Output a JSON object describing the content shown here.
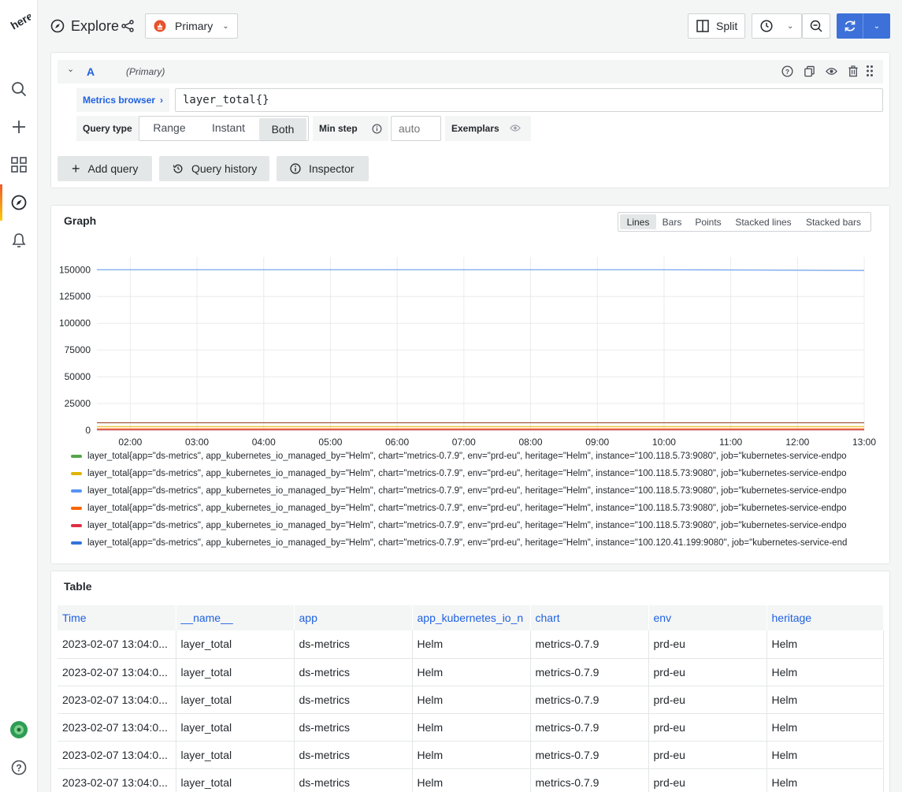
{
  "topbar": {
    "title": "Explore",
    "datasource": "Primary",
    "split_label": "Split"
  },
  "query": {
    "ref_id": "A",
    "datasource_hint": "(Primary)",
    "metrics_browser_label": "Metrics browser",
    "expression": "layer_total{}",
    "query_type_label": "Query type",
    "query_types": [
      "Range",
      "Instant",
      "Both"
    ],
    "selected_query_type": "Both",
    "min_step_label": "Min step",
    "min_step_placeholder": "auto",
    "exemplars_label": "Exemplars"
  },
  "actions": {
    "add_query": "Add query",
    "query_history": "Query history",
    "inspector": "Inspector"
  },
  "graph": {
    "title": "Graph",
    "modes": [
      "Lines",
      "Bars",
      "Points",
      "Stacked lines",
      "Stacked bars"
    ],
    "selected_mode": "Lines",
    "legend": [
      {
        "label": "layer_total{app=\"ds-metrics\", app_kubernetes_io_managed_by=\"Helm\", chart=\"metrics-0.7.9\", env=\"prd-eu\", heritage=\"Helm\", instance=\"100.118.5.73:9080\", job=\"kubernetes-service-endpo",
        "color": "#56a64b"
      },
      {
        "label": "layer_total{app=\"ds-metrics\", app_kubernetes_io_managed_by=\"Helm\", chart=\"metrics-0.7.9\", env=\"prd-eu\", heritage=\"Helm\", instance=\"100.118.5.73:9080\", job=\"kubernetes-service-endpo",
        "color": "#e0b400"
      },
      {
        "label": "layer_total{app=\"ds-metrics\", app_kubernetes_io_managed_by=\"Helm\", chart=\"metrics-0.7.9\", env=\"prd-eu\", heritage=\"Helm\", instance=\"100.118.5.73:9080\", job=\"kubernetes-service-endpo",
        "color": "#5794f2"
      },
      {
        "label": "layer_total{app=\"ds-metrics\", app_kubernetes_io_managed_by=\"Helm\", chart=\"metrics-0.7.9\", env=\"prd-eu\", heritage=\"Helm\", instance=\"100.118.5.73:9080\", job=\"kubernetes-service-endpo",
        "color": "#fa6400"
      },
      {
        "label": "layer_total{app=\"ds-metrics\", app_kubernetes_io_managed_by=\"Helm\", chart=\"metrics-0.7.9\", env=\"prd-eu\", heritage=\"Helm\", instance=\"100.118.5.73:9080\", job=\"kubernetes-service-endpo",
        "color": "#e02f44"
      },
      {
        "label": "layer_total{app=\"ds-metrics\", app_kubernetes_io_managed_by=\"Helm\", chart=\"metrics-0.7.9\", env=\"prd-eu\", heritage=\"Helm\", instance=\"100.120.41.199:9080\", job=\"kubernetes-service-end",
        "color": "#3274d9"
      }
    ]
  },
  "chart_data": {
    "type": "line",
    "x": [
      "01:30",
      "02:00",
      "03:00",
      "04:00",
      "05:00",
      "06:00",
      "07:00",
      "08:00",
      "09:00",
      "10:00",
      "11:00",
      "12:00",
      "13:00"
    ],
    "xticks": [
      "02:00",
      "03:00",
      "04:00",
      "05:00",
      "06:00",
      "07:00",
      "08:00",
      "09:00",
      "10:00",
      "11:00",
      "12:00",
      "13:00"
    ],
    "yticks": [
      0,
      25000,
      50000,
      75000,
      100000,
      125000,
      150000
    ],
    "ylim": [
      0,
      162000
    ],
    "grid": true,
    "series": [
      {
        "values": [
          150000,
          150000,
          150000,
          150000,
          150000,
          150000,
          150000,
          150000,
          150000,
          150000,
          149800,
          149500,
          149300
        ],
        "color": "#5794f2"
      },
      {
        "values": [
          7000,
          7000,
          7000,
          7000,
          7000,
          7000,
          7000,
          7000,
          7000,
          7000,
          7000,
          7000,
          7000
        ],
        "color": "#8f3f1c"
      },
      {
        "values": [
          3500,
          3500,
          3500,
          3500,
          3500,
          3500,
          3500,
          3500,
          3500,
          3500,
          3500,
          3500,
          3500
        ],
        "color": "#e0b400"
      },
      {
        "values": [
          1500,
          1500,
          1500,
          1500,
          1500,
          1500,
          1500,
          1500,
          1500,
          1500,
          1500,
          1500,
          1500
        ],
        "color": "#fa6400"
      },
      {
        "values": [
          500,
          500,
          500,
          500,
          500,
          500,
          500,
          500,
          500,
          500,
          500,
          500,
          500
        ],
        "color": "#c4162a"
      }
    ]
  },
  "table": {
    "title": "Table",
    "columns": [
      "Time",
      "__name__",
      "app",
      "app_kubernetes_io_n",
      "chart",
      "env",
      "heritage"
    ],
    "rows": [
      [
        "2023-02-07 13:04:0...",
        "layer_total",
        "ds-metrics",
        "Helm",
        "metrics-0.7.9",
        "prd-eu",
        "Helm"
      ],
      [
        "2023-02-07 13:04:0...",
        "layer_total",
        "ds-metrics",
        "Helm",
        "metrics-0.7.9",
        "prd-eu",
        "Helm"
      ],
      [
        "2023-02-07 13:04:0...",
        "layer_total",
        "ds-metrics",
        "Helm",
        "metrics-0.7.9",
        "prd-eu",
        "Helm"
      ],
      [
        "2023-02-07 13:04:0...",
        "layer_total",
        "ds-metrics",
        "Helm",
        "metrics-0.7.9",
        "prd-eu",
        "Helm"
      ],
      [
        "2023-02-07 13:04:0...",
        "layer_total",
        "ds-metrics",
        "Helm",
        "metrics-0.7.9",
        "prd-eu",
        "Helm"
      ],
      [
        "2023-02-07 13:04:0...",
        "layer_total",
        "ds-metrics",
        "Helm",
        "metrics-0.7.9",
        "prd-eu",
        "Helm"
      ]
    ]
  },
  "colors": {
    "accent": "#1f62e0",
    "primary_button": "#3d71d9"
  }
}
